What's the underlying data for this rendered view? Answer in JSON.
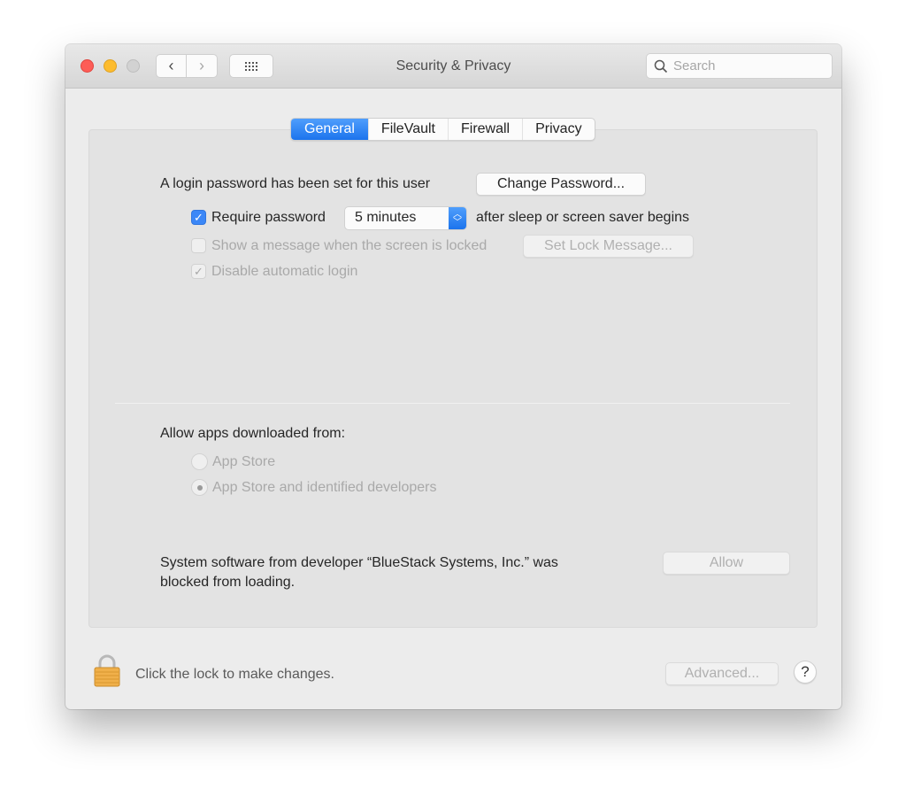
{
  "window": {
    "title": "Security & Privacy",
    "search_placeholder": "Search",
    "nav": {
      "back": "‹",
      "forward": "›"
    }
  },
  "tabs": [
    {
      "label": "General",
      "active": true
    },
    {
      "label": "FileVault",
      "active": false
    },
    {
      "label": "Firewall",
      "active": false
    },
    {
      "label": "Privacy",
      "active": false
    }
  ],
  "general": {
    "login_password_text": "A login password has been set for this user",
    "change_password_label": "Change Password...",
    "require_password": {
      "label": "Require password",
      "checked": true
    },
    "require_password_delay": "5 minutes",
    "after_sleep_text": "after sleep or screen saver begins",
    "show_message": {
      "label": "Show a message when the screen is locked",
      "checked": false,
      "enabled": false
    },
    "set_lock_message_label": "Set Lock Message...",
    "disable_auto_login": {
      "label": "Disable automatic login",
      "checked": true,
      "enabled": false
    },
    "allow_apps_heading": "Allow apps downloaded from:",
    "allow_apps_options": [
      {
        "label": "App Store",
        "selected": false
      },
      {
        "label": "App Store and identified developers",
        "selected": true
      }
    ],
    "blocked_line1": "System software from developer “BlueStack Systems, Inc.” was",
    "blocked_line2": "blocked from loading.",
    "allow_label": "Allow"
  },
  "footer": {
    "lock_text": "Click the lock to make changes.",
    "advanced_label": "Advanced...",
    "help_label": "?"
  },
  "colors": {
    "accent": "#1c74ed",
    "close": "#fd5d57",
    "minimize": "#fdbc2e",
    "zoom_disabled": "#d2d2d2"
  }
}
